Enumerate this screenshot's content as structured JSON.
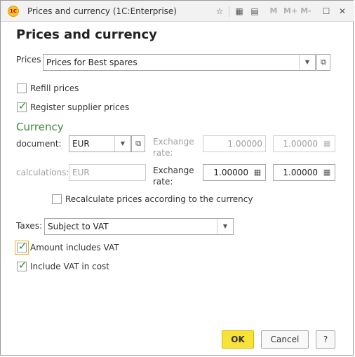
{
  "window": {
    "title": "Prices and currency  (1C:Enterprise)",
    "heading": "Prices and currency",
    "app_icon_text": "1C",
    "title_buttons": [
      "M",
      "M+",
      "M-"
    ]
  },
  "prices": {
    "label": "Prices",
    "value": "Prices for Best spares"
  },
  "refill_prices": {
    "label": "Refill prices",
    "checked": false
  },
  "register_supplier_prices": {
    "label": "Register supplier prices",
    "checked": true
  },
  "currency": {
    "section_title": "Currency",
    "document_label": "document:",
    "document_value": "EUR",
    "exchange_rate_label_1": "Exchange rate:",
    "document_rate": "1.00000",
    "document_multiplicity": "1.00000",
    "calculations_label": "calculations:",
    "calculations_value": "EUR",
    "exchange_rate_label_2": "Exchange rate:",
    "calc_rate": "1.00000",
    "calc_multiplicity": "1.00000",
    "recalculate_label": "Recalculate prices according to the currency",
    "recalculate_checked": false
  },
  "taxes": {
    "label": "Taxes:",
    "value": "Subject to VAT"
  },
  "amount_includes_vat": {
    "label": "Amount includes VAT",
    "checked": true
  },
  "include_vat_in_cost": {
    "label": "Include VAT in cost",
    "checked": true
  },
  "buttons": {
    "ok": "OK",
    "cancel": "Cancel",
    "help": "?"
  },
  "colors": {
    "accent_green": "#3a8a3a",
    "ok_yellow": "#f7e23a"
  }
}
